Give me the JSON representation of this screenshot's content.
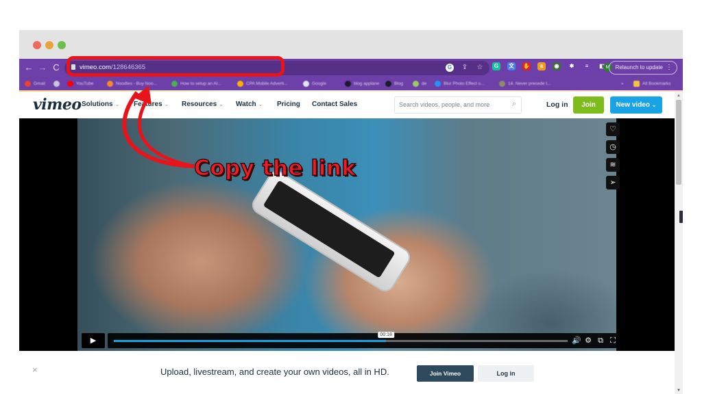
{
  "browser": {
    "url_domain": "vimeo.com",
    "url_path": "/128646365",
    "relaunch_label": "Relaunch to update",
    "profile_initial": "M",
    "nav_icons": [
      "back-arrow-icon",
      "forward-arrow-icon",
      "reload-icon"
    ],
    "omnibox_icons": [
      "google-lens-icon",
      "share-icon",
      "bookmark-star-icon"
    ],
    "extensions": [
      {
        "name": "grammarly-extension-icon",
        "glyph": "G",
        "color": "#15c39a"
      },
      {
        "name": "translate-extension-icon",
        "glyph": "文",
        "color": "#4a7ef0"
      },
      {
        "name": "adblock-extension-icon",
        "glyph": "✋",
        "color": "#d8242a"
      },
      {
        "name": "amazon-extension-icon",
        "glyph": "a",
        "color": "#f29b1f"
      },
      {
        "name": "ext-generic-icon",
        "glyph": "◉",
        "color": "#3f6b3f"
      },
      {
        "name": "extensions-puzzle-icon",
        "glyph": "✱",
        "color": "#6d3fa8"
      },
      {
        "name": "media-controls-icon",
        "glyph": "≡",
        "color": "#6d3fa8"
      },
      {
        "name": "side-panel-icon",
        "glyph": "◧",
        "color": "#6d3fa8"
      }
    ],
    "bookmarks": [
      {
        "label": "Gmail",
        "color": "#ea4335"
      },
      {
        "label": "",
        "color": "#c8c8d8"
      },
      {
        "label": "YouTube",
        "color": "#ff0000"
      },
      {
        "label": "Noodles - Buy Noo...",
        "color": "#f58a2c"
      },
      {
        "label": "How to setup an AI...",
        "color": "#4caf50"
      },
      {
        "label": "CPA Mobile Adverti...",
        "color": "#ffb300"
      },
      {
        "label": "Google",
        "color": "#dfe7f0"
      },
      {
        "label": "blog applane",
        "color": "#1a1a2e"
      },
      {
        "label": "Blog",
        "color": "#1a1a2e"
      },
      {
        "label": "de",
        "color": "#9ccc65"
      },
      {
        "label": "Blur Photo Effect o...",
        "color": "#2196f3"
      },
      {
        "label": "14. Never precede t...",
        "color": "#8d8d6a"
      }
    ],
    "all_bookmarks_label": "All Bookmarks"
  },
  "vimeo": {
    "logo": "vimeo",
    "nav": [
      {
        "label": "Solutions",
        "has_menu": true
      },
      {
        "label": "Features",
        "has_menu": true
      },
      {
        "label": "Resources",
        "has_menu": true
      },
      {
        "label": "Watch",
        "has_menu": true
      },
      {
        "label": "Pricing",
        "has_menu": false
      },
      {
        "label": "Contact Sales",
        "has_menu": false
      }
    ],
    "search_placeholder": "Search videos, people, and more",
    "login_label": "Log in",
    "join_label": "Join",
    "new_video_label": "New video",
    "colors": {
      "join": "#7ebb1c",
      "new_video": "#17a3e5",
      "text": "#1a2e3b"
    }
  },
  "player": {
    "side_actions": [
      "like-heart-icon",
      "watch-later-clock-icon",
      "collections-layers-icon",
      "share-send-icon"
    ],
    "play_icon": "▶",
    "progress_fraction": 0.6,
    "hover_time": "00:18",
    "control_icons": [
      {
        "name": "volume-icon",
        "glyph": "🔊"
      },
      {
        "name": "settings-gear-icon",
        "glyph": "⚙"
      },
      {
        "name": "picture-in-picture-icon",
        "glyph": "⧉"
      },
      {
        "name": "fullscreen-icon",
        "glyph": "⛶"
      }
    ],
    "accent": "#17a3e5"
  },
  "banner": {
    "close_glyph": "×",
    "text": "Upload, livestream, and create your own videos, all in HD.",
    "join_label": "Join Vimeo",
    "login_label": "Log in"
  },
  "annotation": {
    "text": "Copy the link",
    "color": "#ee1c24"
  }
}
